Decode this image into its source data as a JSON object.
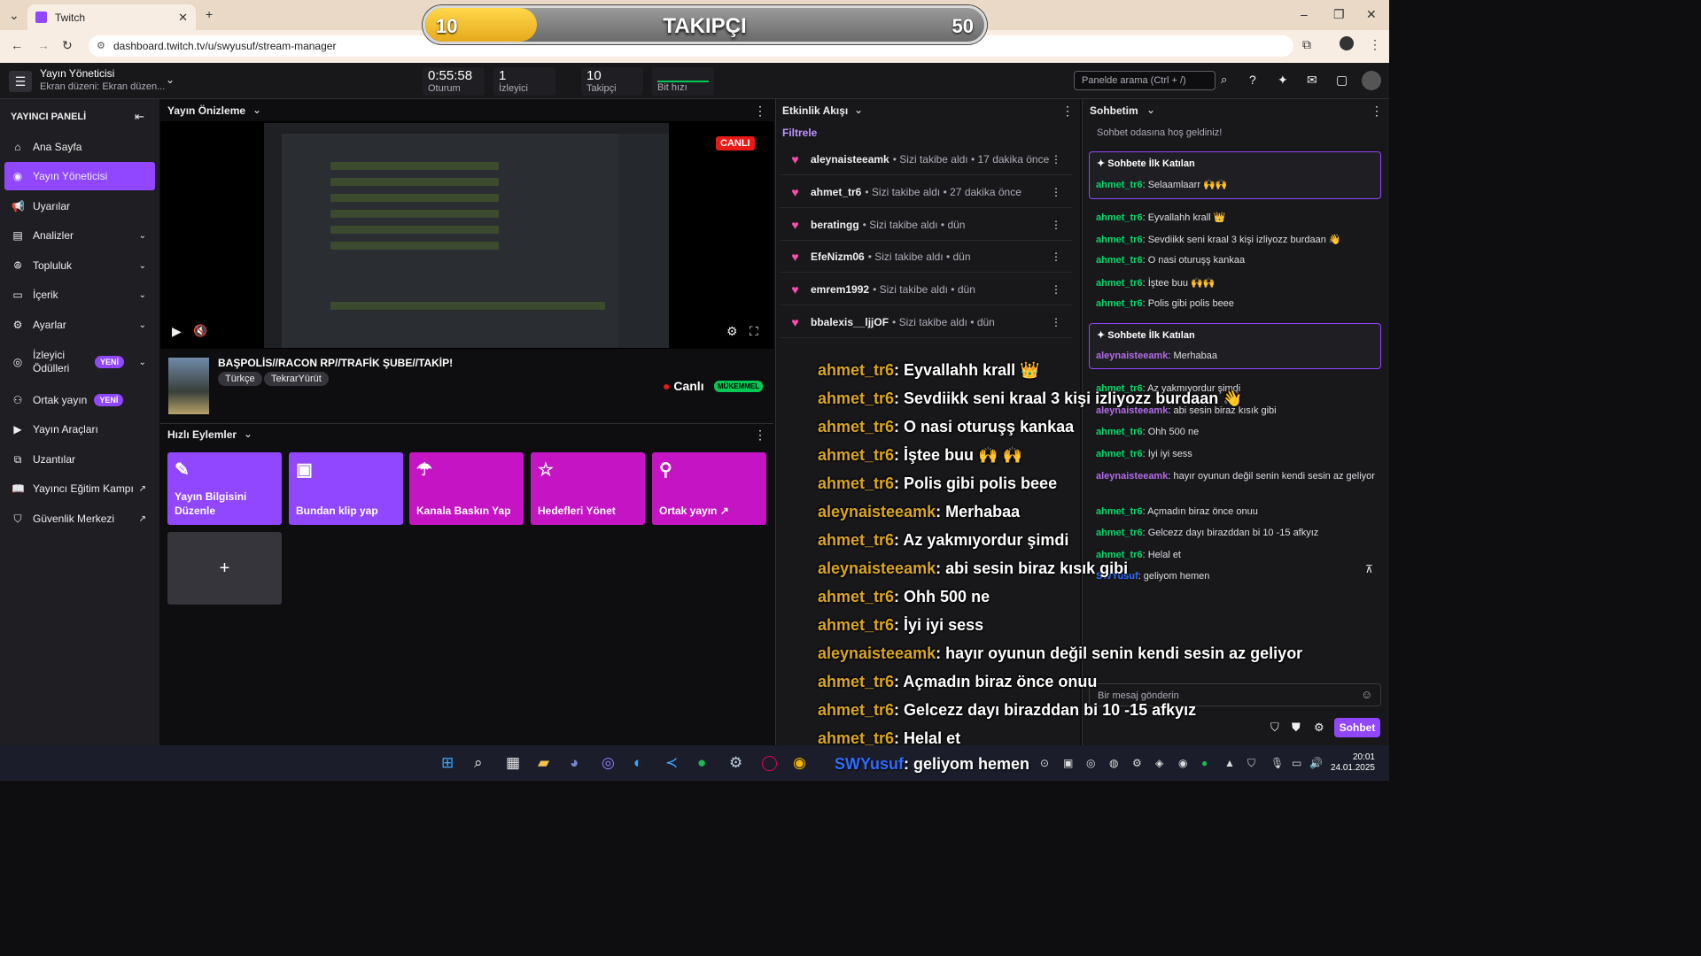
{
  "browser": {
    "tab_title": "Twitch",
    "url": "dashboard.twitch.tv/u/swyusuf/stream-manager"
  },
  "overlay": {
    "current": "10",
    "title": "TAKIPÇI",
    "goal": "50",
    "progress": 0.2
  },
  "header": {
    "title": "Yayın Yöneticisi",
    "subtitle": "Ekran düzeni: Ekran düzen...",
    "stats": [
      {
        "value": "0:55:58",
        "label": "Oturum"
      },
      {
        "value": "1",
        "label": "İzleyici"
      },
      {
        "value": "10",
        "label": "Takipçi"
      },
      {
        "value": "",
        "label": "Bit hızı"
      }
    ],
    "search_placeholder": "Panelde arama (Ctrl + /)"
  },
  "sidebar": {
    "heading": "YAYINCI PANELİ",
    "items": [
      {
        "label": "Ana Sayfa",
        "icon": "home-icon"
      },
      {
        "label": "Yayın Yöneticisi",
        "icon": "broadcast-icon",
        "active": true
      },
      {
        "label": "Uyarılar",
        "icon": "megaphone-icon"
      },
      {
        "label": "Analizler",
        "icon": "chart-icon"
      },
      {
        "label": "Topluluk",
        "icon": "community-icon"
      },
      {
        "label": "İçerik",
        "icon": "content-icon"
      },
      {
        "label": "Ayarlar",
        "icon": "gear-icon"
      },
      {
        "label": "İzleyici Ödülleri",
        "icon": "reward-icon",
        "badge": "YENİ"
      },
      {
        "label": "Ortak yayın",
        "icon": "collab-icon",
        "badge": "YENİ"
      },
      {
        "label": "Yayın Araçları",
        "icon": "camera-icon"
      },
      {
        "label": "Uzantılar",
        "icon": "extension-icon"
      },
      {
        "label": "Yayıncı Eğitim Kampı",
        "icon": "book-icon"
      },
      {
        "label": "Güvenlik Merkezi",
        "icon": "shield-icon"
      }
    ]
  },
  "preview": {
    "heading": "Yayın Önizleme",
    "live_tag": "CANLI",
    "stream_title": "BAŞPOLİS//RACON RP//TRAFİK ŞUBE//TAKİP!",
    "tags": [
      "Türkçe",
      "TekrarYürüt"
    ],
    "status": "Canlı",
    "quality": "MÜKEMMEL"
  },
  "quick_actions": {
    "heading": "Hızlı Eylemler",
    "items": [
      {
        "label": "Yayın Bilgisini Düzenle",
        "color": "#9146ff",
        "icon": "pencil-icon",
        "glyph": "✎"
      },
      {
        "label": "Bundan klip yap",
        "color": "#9146ff",
        "icon": "clip-icon",
        "glyph": "🎬"
      },
      {
        "label": "Kanala Baskın Yap",
        "color": "#c414c4",
        "icon": "raid-icon",
        "glyph": "☂"
      },
      {
        "label": "Hedefleri Yönet",
        "color": "#c414c4",
        "icon": "star-icon",
        "glyph": "☆"
      },
      {
        "label": "Ortak yayın ↗",
        "color": "#c414c4",
        "icon": "add-user-icon",
        "glyph": "👤"
      }
    ],
    "add": "+"
  },
  "activity": {
    "heading": "Etkinlik Akışı",
    "filter": "Filtrele",
    "items": [
      {
        "user": "aleynaisteeamk",
        "text": "• Sizi takibe aldı • 17 dakika önce"
      },
      {
        "user": "ahmet_tr6",
        "text": "• Sizi takibe aldı • 27 dakika önce"
      },
      {
        "user": "beratingg",
        "text": "• Sizi takibe aldı • dün"
      },
      {
        "user": "EfeNizm06",
        "text": "• Sizi takibe aldı • dün"
      },
      {
        "user": "emrem1992",
        "text": "• Sizi takibe aldı • dün"
      },
      {
        "user": "bbalexis__ljjOF",
        "text": "• Sizi takibe aldı • dün"
      }
    ]
  },
  "overlay_chat": [
    {
      "user": "ahmet_tr6",
      "msg": ": Eyvallahh krall 👑"
    },
    {
      "user": "ahmet_tr6",
      "msg": ": Sevdiikk seni kraal 3 kişi izliyozz burdaan 👋"
    },
    {
      "user": "ahmet_tr6",
      "msg": ": O nasi oturuşş kankaa"
    },
    {
      "user": "ahmet_tr6",
      "msg": ": İştee buu 🙌 🙌"
    },
    {
      "user": "ahmet_tr6",
      "msg": ": Polis gibi polis beee"
    },
    {
      "user": "aleynaisteeamk",
      "msg": ": Merhabaa"
    },
    {
      "user": "ahmet_tr6",
      "msg": ": Az yakmıyordur şimdi"
    },
    {
      "user": "aleynaisteeamk",
      "msg": ": abi sesin biraz kısık gibi"
    },
    {
      "user": "ahmet_tr6",
      "msg": ": Ohh 500 ne"
    },
    {
      "user": "ahmet_tr6",
      "msg": ": İyi iyi sess"
    },
    {
      "user": "aleynaisteeamk",
      "msg": ": hayır oyunun değil senin kendi sesin az geliyor"
    },
    {
      "user": "ahmet_tr6",
      "msg": ": Açmadın biraz önce onuu"
    },
    {
      "user": "ahmet_tr6",
      "msg": ": Gelcezz dayı birazddan bi 10 -15 afkyız"
    },
    {
      "user": "ahmet_tr6",
      "msg": ": Helal et"
    }
  ],
  "chat": {
    "heading": "Sohbetim",
    "welcome": "Sohbet odasına hoş geldiniz!",
    "first_joined": "Sohbete İlk Katılan",
    "messages": [
      {
        "user": "ahmet_tr6",
        "msg": ": Selaamlaarr 🙌🙌",
        "boxed": true
      },
      {
        "user": "ahmet_tr6",
        "msg": ": Eyvallahh krall 👑"
      },
      {
        "user": "ahmet_tr6",
        "msg": ": Sevdiikk seni kraal 3 kişi izliyozz burdaan 👋"
      },
      {
        "user": "ahmet_tr6",
        "msg": ": O nasi oturuşş kankaa"
      },
      {
        "user": "ahmet_tr6",
        "msg": ": İştee buu 🙌🙌"
      },
      {
        "user": "ahmet_tr6",
        "msg": ": Polis gibi polis beee"
      },
      {
        "user": "aleynaisteeamk",
        "msg": ": Merhabaa",
        "boxed": true
      },
      {
        "user": "ahmet_tr6",
        "msg": ": Az yakmıyordur şimdi"
      },
      {
        "user": "aleynaisteeamk",
        "msg": ": abi sesin biraz kısık gibi"
      },
      {
        "user": "ahmet_tr6",
        "msg": ": Ohh 500 ne"
      },
      {
        "user": "ahmet_tr6",
        "msg": ": İyi iyi sess"
      },
      {
        "user": "aleynaisteeamk",
        "msg": ": hayır oyunun değil senin kendi sesin az geliyor"
      },
      {
        "user": "ahmet_tr6",
        "msg": ": Açmadın biraz önce onuu"
      },
      {
        "user": "ahmet_tr6",
        "msg": ": Gelcezz dayı birazddan bi 10 -15 afkyız"
      },
      {
        "user": "ahmet_tr6",
        "msg": ": Helal et"
      },
      {
        "user": "SWYusuf",
        "msg": ": geliyom hemen"
      }
    ],
    "input_placeholder": "Bir mesaj gönderin",
    "send_label": "Sohbet"
  },
  "taskbar": {
    "overlay_user": "SWYusuf",
    "overlay_msg": ": geliyom hemen",
    "time": "20:01",
    "date": "24.01.2025"
  }
}
